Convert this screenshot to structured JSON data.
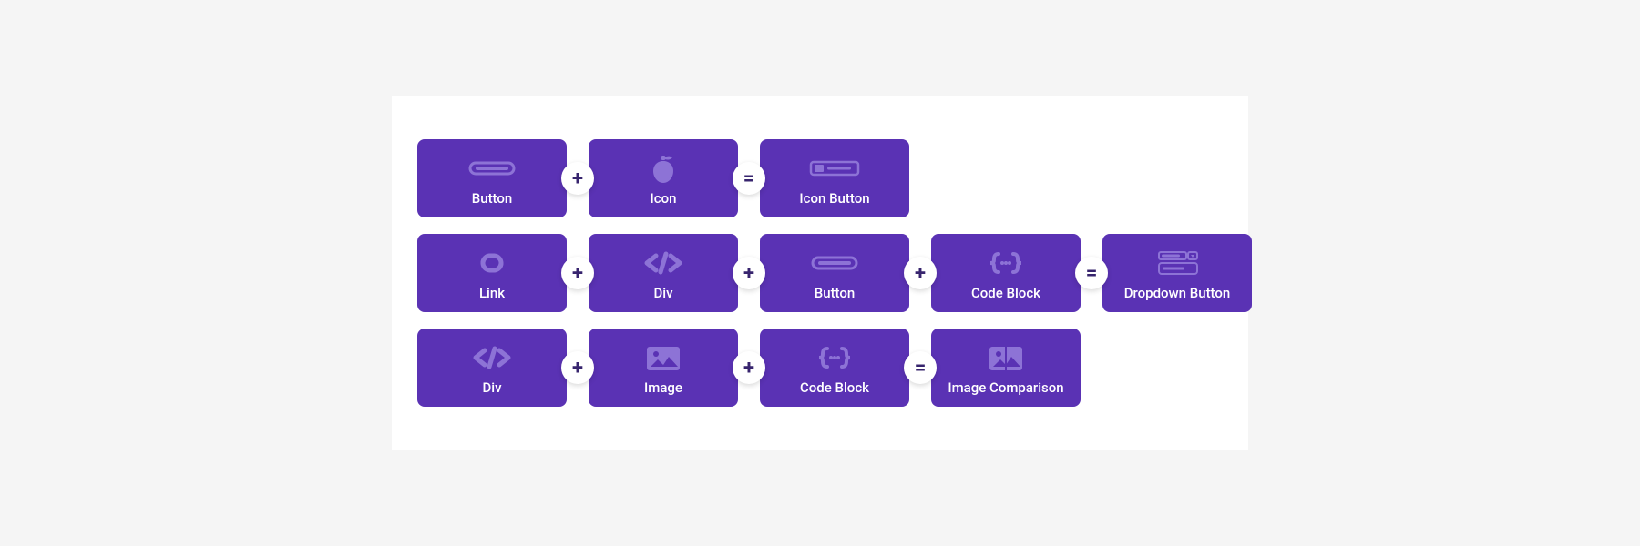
{
  "operators": {
    "plus": "+",
    "equals": "="
  },
  "colors": {
    "card": "#5a32b4",
    "pictogram": "#8d73d6"
  },
  "rows": [
    {
      "parts": [
        {
          "icon": "button",
          "label": "Button"
        },
        {
          "icon": "icon",
          "label": "Icon"
        }
      ],
      "result": {
        "icon": "icon-button",
        "label": "Icon Button"
      }
    },
    {
      "parts": [
        {
          "icon": "link",
          "label": "Link"
        },
        {
          "icon": "div",
          "label": "Div"
        },
        {
          "icon": "button",
          "label": "Button"
        },
        {
          "icon": "code-block",
          "label": "Code Block"
        }
      ],
      "result": {
        "icon": "dropdown-button",
        "label": "Dropdown Button"
      }
    },
    {
      "parts": [
        {
          "icon": "div",
          "label": "Div"
        },
        {
          "icon": "image",
          "label": "Image"
        },
        {
          "icon": "code-block",
          "label": "Code Block"
        }
      ],
      "result": {
        "icon": "image-comparison",
        "label": "Image Comparison"
      }
    }
  ]
}
